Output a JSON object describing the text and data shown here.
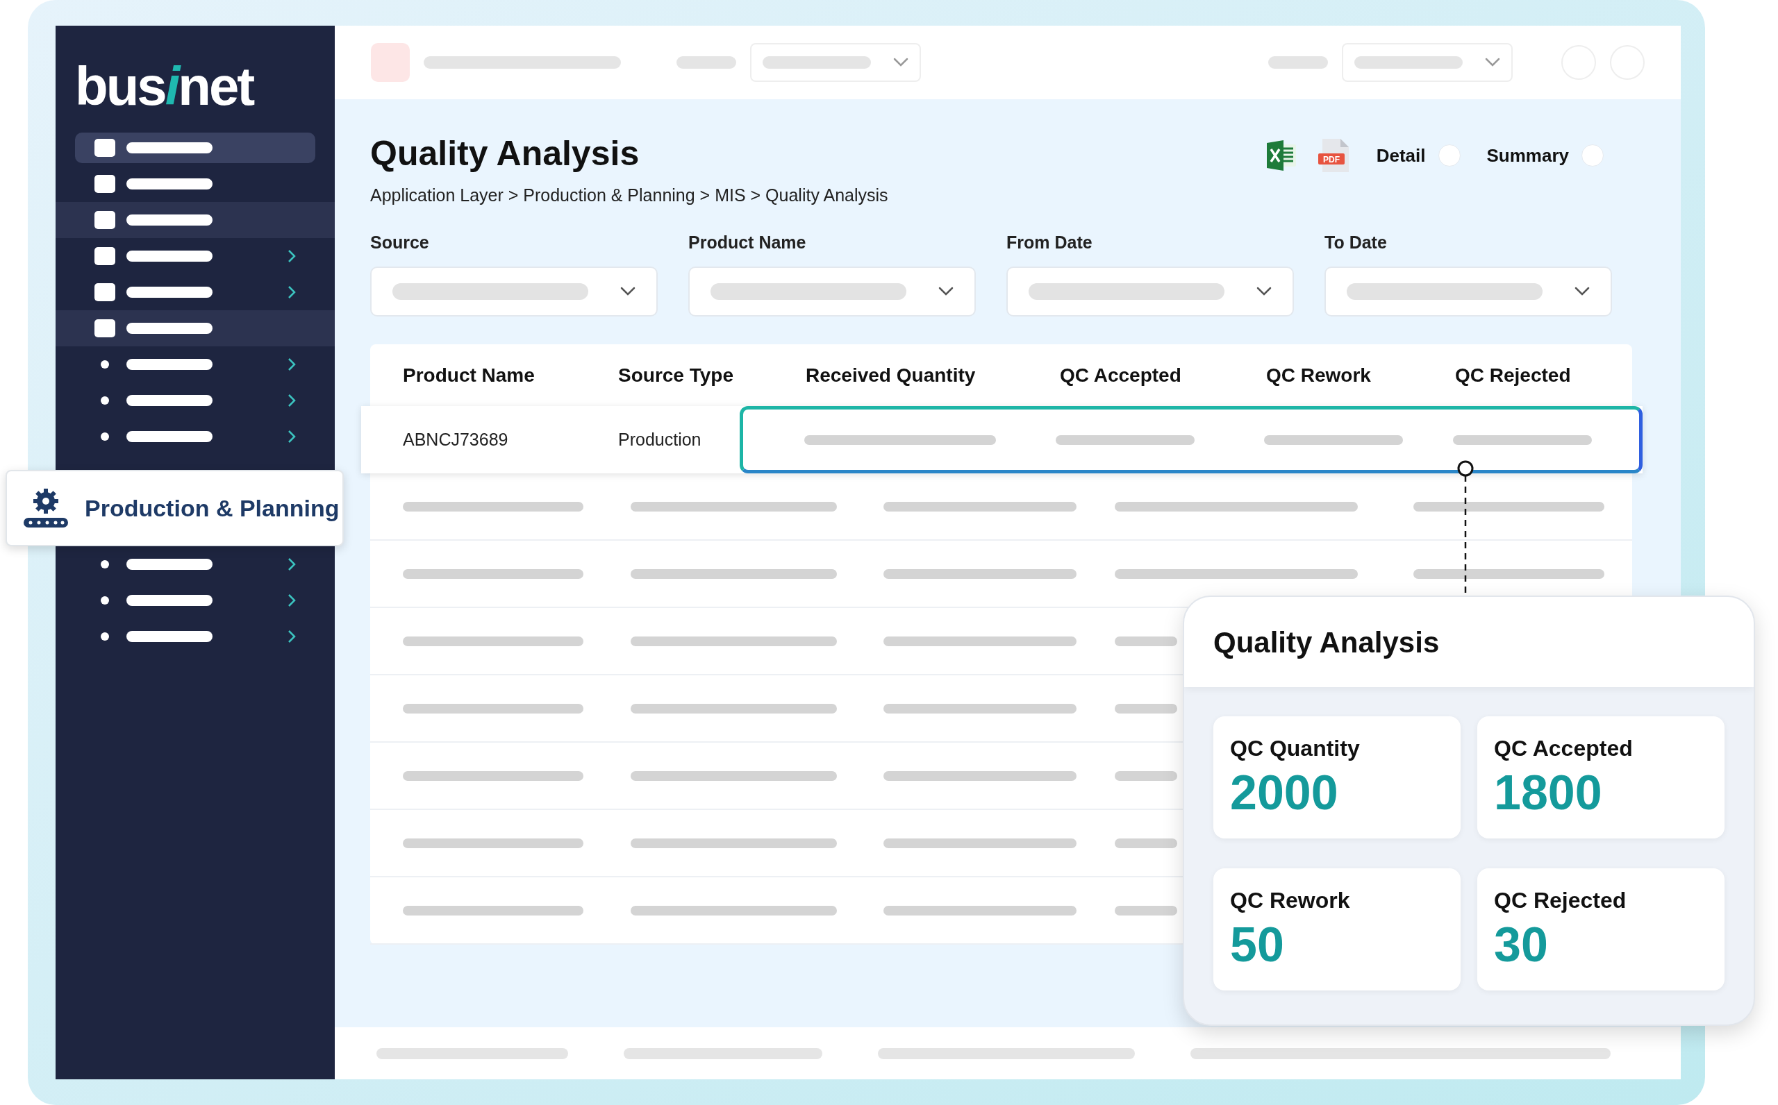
{
  "logo": {
    "before": "bus",
    "accent": "i",
    "after": "net"
  },
  "sidebar": {
    "items": [
      {
        "kind": "square",
        "selected": true,
        "highlighted": false,
        "expandable": false
      },
      {
        "kind": "square",
        "selected": false,
        "highlighted": false,
        "expandable": false
      },
      {
        "kind": "square",
        "selected": false,
        "highlighted": true,
        "expandable": false
      },
      {
        "kind": "square",
        "selected": false,
        "highlighted": false,
        "expandable": true
      },
      {
        "kind": "square",
        "selected": false,
        "highlighted": false,
        "expandable": true
      },
      {
        "kind": "square",
        "selected": false,
        "highlighted": true,
        "expandable": false
      },
      {
        "kind": "bullet",
        "selected": false,
        "highlighted": false,
        "expandable": true
      },
      {
        "kind": "bullet",
        "selected": false,
        "highlighted": false,
        "expandable": true
      },
      {
        "kind": "bullet",
        "selected": false,
        "highlighted": false,
        "expandable": true
      },
      {
        "kind": "gap"
      },
      {
        "kind": "bullet",
        "selected": false,
        "highlighted": false,
        "expandable": true
      },
      {
        "kind": "bullet",
        "selected": false,
        "highlighted": false,
        "expandable": true
      },
      {
        "kind": "bullet",
        "selected": false,
        "highlighted": false,
        "expandable": true
      }
    ],
    "module_tab": {
      "label": "Production & Planning"
    }
  },
  "page": {
    "title": "Quality Analysis",
    "breadcrumb": "Application Layer > Production & Planning > MIS > Quality Analysis",
    "export": {
      "pdf_label": "PDF"
    },
    "view_options": [
      {
        "label": "Detail",
        "selected": false
      },
      {
        "label": "Summary",
        "selected": false
      }
    ]
  },
  "filters": [
    {
      "label": "Source"
    },
    {
      "label": "Product Name"
    },
    {
      "label": "From Date"
    },
    {
      "label": "To Date"
    }
  ],
  "table": {
    "columns": [
      "Product Name",
      "Source Type",
      "Received Quantity",
      "QC Accepted",
      "QC Rework",
      "QC Rejected"
    ],
    "rows": [
      {
        "product_name": "ABNCJ73689",
        "source_type": "Production",
        "selected": true
      }
    ]
  },
  "popup": {
    "title": "Quality Analysis",
    "stats": [
      {
        "label": "QC Quantity",
        "value": "2000"
      },
      {
        "label": "QC Accepted",
        "value": "1800"
      },
      {
        "label": "QC Rework",
        "value": "50"
      },
      {
        "label": "QC Rejected",
        "value": "30"
      }
    ]
  }
}
